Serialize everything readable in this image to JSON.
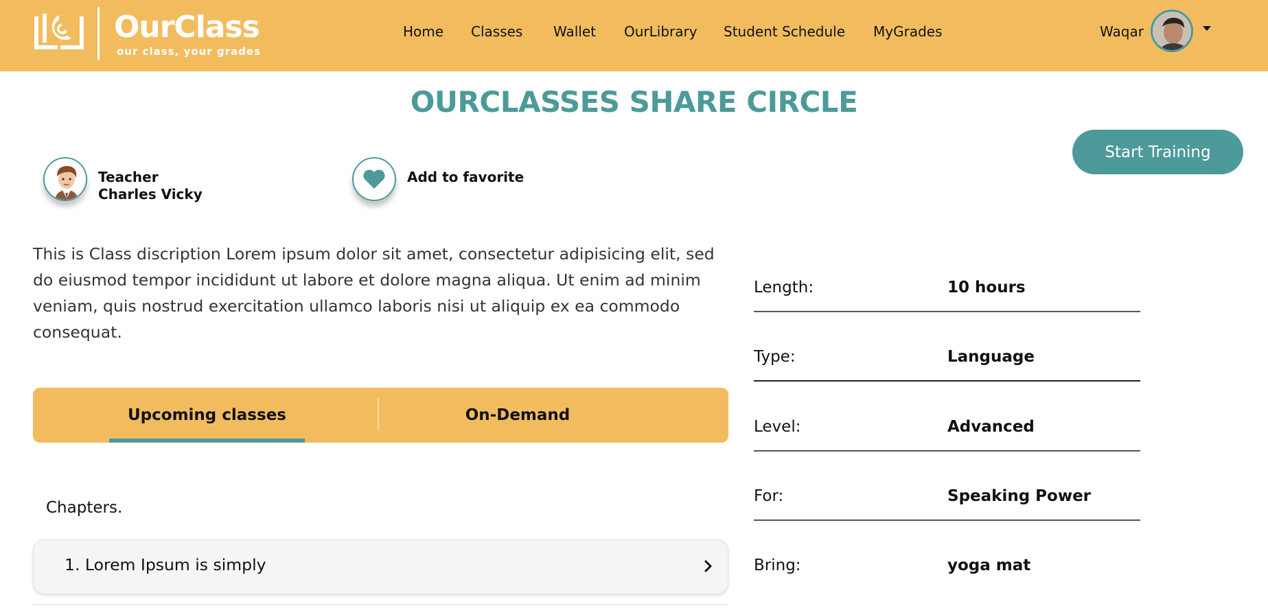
{
  "brand": {
    "name": "OurClass",
    "tagline": "our class, your grades",
    "colors": {
      "header": "#F2BC5E",
      "accent": "#4C9A99"
    }
  },
  "nav": {
    "items": [
      {
        "label": "Home"
      },
      {
        "label": "Classes"
      },
      {
        "label": "Wallet"
      },
      {
        "label": "OurLibrary"
      },
      {
        "label": "Student Schedule"
      },
      {
        "label": "MyGrades"
      }
    ]
  },
  "user": {
    "name": "Waqar",
    "menu_icon": "caret-down-icon"
  },
  "page": {
    "title": "OURCLASSES SHARE CIRCLE",
    "start_button": "Start Training"
  },
  "teacher": {
    "role": "Teacher",
    "name": "Charles Vicky"
  },
  "favorite": {
    "label": "Add to favorite",
    "icon": "heart-icon"
  },
  "description": "This is Class discription Lorem ipsum dolor sit amet, consectetur adipisicing elit, sed do eiusmod tempor incididunt ut labore et dolore magna aliqua. Ut enim ad minim veniam, quis nostrud exercitation ullamco laboris nisi ut aliquip ex ea commodo consequat.",
  "tabs": [
    {
      "label": "Upcoming classes",
      "active": true
    },
    {
      "label": "On-Demand",
      "active": false
    }
  ],
  "chapters": {
    "label": "Chapters.",
    "items": [
      {
        "title": "1. Lorem Ipsum is simply"
      }
    ]
  },
  "details": [
    {
      "label": "Length:",
      "value": "10 hours"
    },
    {
      "label": "Type:",
      "value": "Language"
    },
    {
      "label": "Level:",
      "value": "Advanced"
    },
    {
      "label": "For:",
      "value": "Speaking Power"
    },
    {
      "label": "Bring:",
      "value": "yoga mat"
    }
  ]
}
